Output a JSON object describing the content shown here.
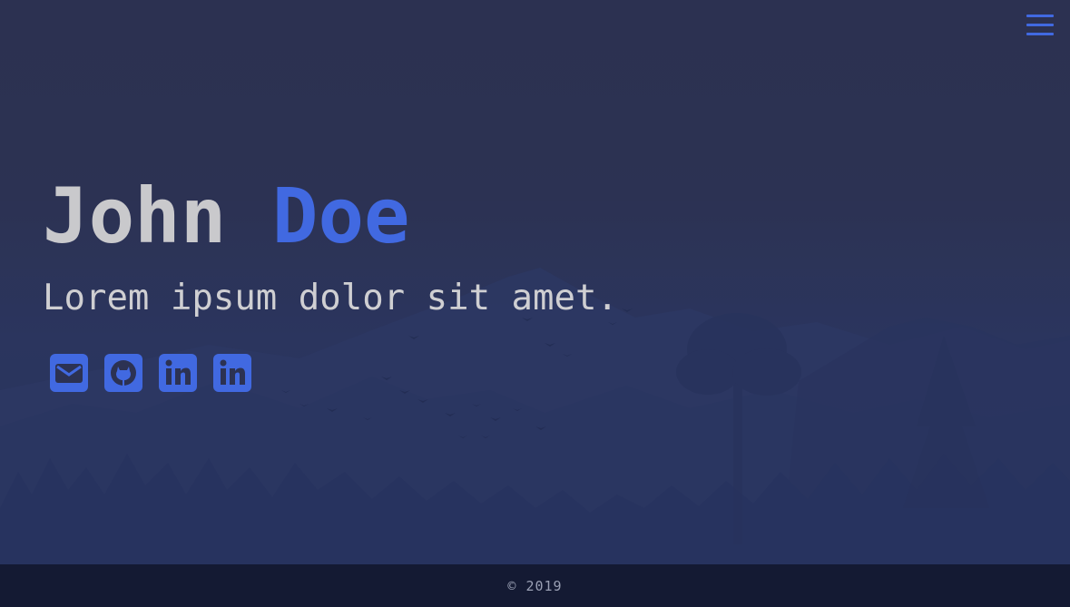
{
  "header": {
    "menu_icon": "hamburger-menu-icon"
  },
  "hero": {
    "first_name": "John",
    "last_name": "Doe",
    "tagline": "Lorem ipsum dolor sit amet."
  },
  "socials": [
    {
      "icon": "envelope-icon"
    },
    {
      "icon": "github-icon"
    },
    {
      "icon": "linkedin-icon"
    },
    {
      "icon": "linkedin-icon"
    }
  ],
  "footer": {
    "copyright": "© 2019"
  },
  "colors": {
    "accent": "#4169e1",
    "background": "#2c3253",
    "footer": "#141a33",
    "text": "#cfcfd2"
  }
}
